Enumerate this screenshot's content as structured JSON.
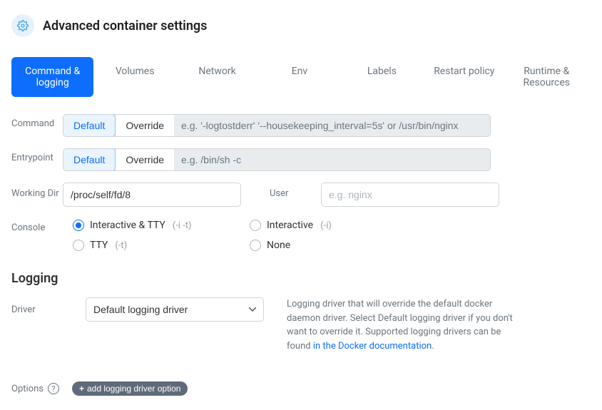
{
  "title": "Advanced container settings",
  "tabs": {
    "command": "Command & logging",
    "volumes": "Volumes",
    "network": "Network",
    "env": "Env",
    "labels": "Labels",
    "restart": "Restart policy",
    "runtime": "Runtime & Resources"
  },
  "labels": {
    "command": "Command",
    "entrypoint": "Entrypoint",
    "workingDir": "Working Dir",
    "user": "User",
    "console": "Console",
    "logging": "Logging",
    "driver": "Driver",
    "options": "Options"
  },
  "toggle": {
    "default": "Default",
    "override": "Override"
  },
  "placeholders": {
    "command": "e.g. '-logtostderr' '--housekeeping_interval=5s' or /usr/bin/nginx",
    "entrypoint": "e.g. /bin/sh -c",
    "user": "e.g. nginx"
  },
  "values": {
    "workingDir": "/proc/self/fd/8"
  },
  "console": {
    "interactiveTty": "Interactive & TTY",
    "interactiveTtyHint": "(-i -t)",
    "tty": "TTY",
    "ttyHint": "(-t)",
    "interactive": "Interactive",
    "interactiveHint": "(-i)",
    "none": "None"
  },
  "driver": {
    "selected": "Default logging driver"
  },
  "help": {
    "driverText": "Logging driver that will override the default docker daemon driver. Select Default logging driver if you don't want to override it. Supported logging drivers can be found ",
    "driverLink": "in the Docker documentation"
  },
  "addBtn": "add logging driver option"
}
